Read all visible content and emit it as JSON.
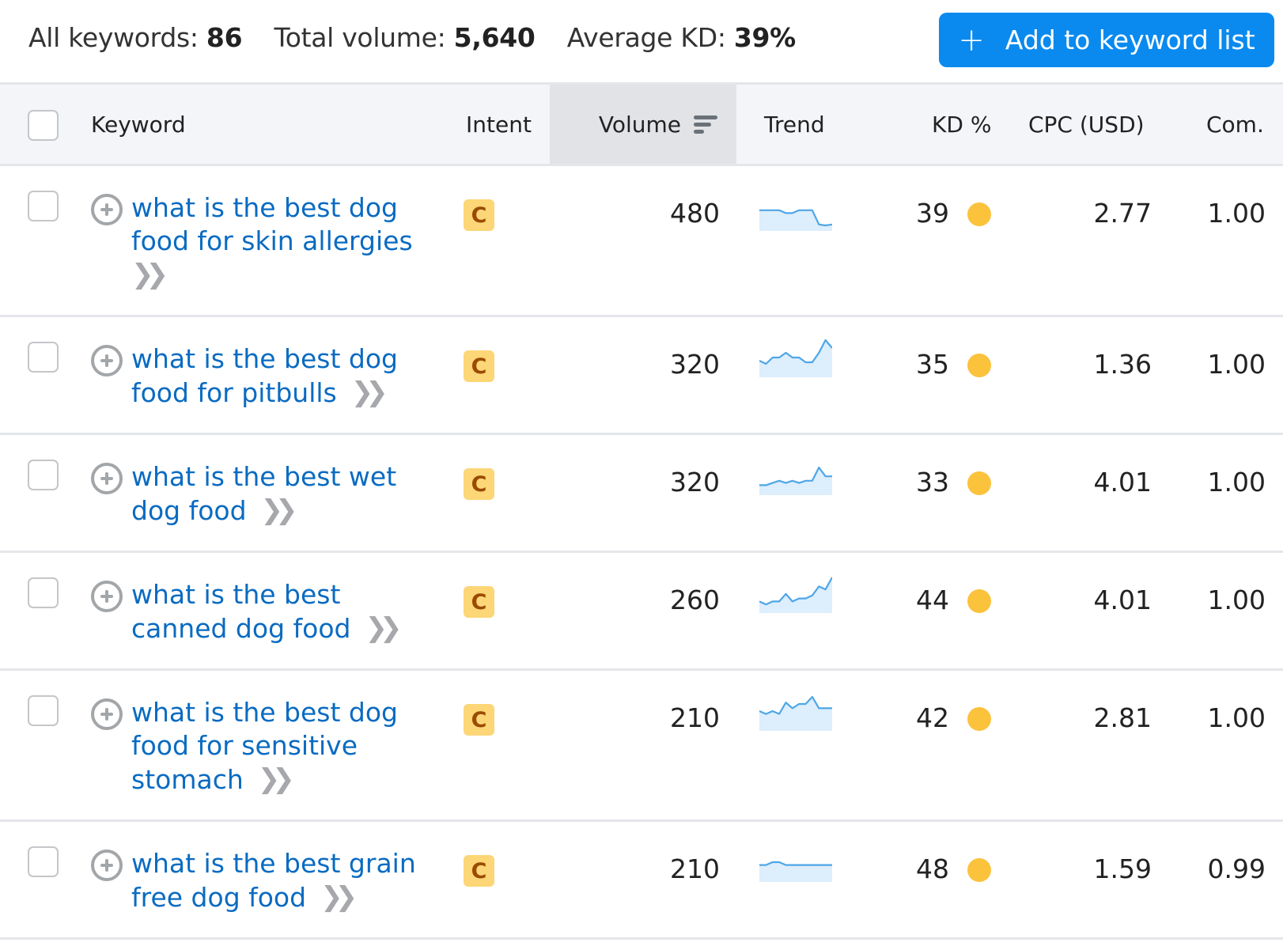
{
  "summary": {
    "all_keywords_label": "All keywords:",
    "all_keywords_value": "86",
    "total_volume_label": "Total volume:",
    "total_volume_value": "5,640",
    "avg_kd_label": "Average KD:",
    "avg_kd_value": "39%"
  },
  "toolbar": {
    "add_button_icon": "+",
    "add_button_label": "Add to keyword list"
  },
  "colors": {
    "accent": "#0a8aef",
    "link": "#0a6bc1",
    "intent_badge_bg": "#fcd677",
    "intent_badge_text": "#9a4b00",
    "kd_dot": "#fbc23c",
    "sparkline": "#4ea6e8",
    "sparkline_fill": "#ddeefc"
  },
  "table": {
    "columns": {
      "keyword": "Keyword",
      "intent": "Intent",
      "volume": "Volume",
      "trend": "Trend",
      "kd": "KD %",
      "cpc": "CPC (USD)",
      "com": "Com."
    },
    "sorted_by": "volume",
    "rows": [
      {
        "keyword": "what is the best dog food for skin allergies",
        "intent": "C",
        "volume": "480",
        "trend": [
          0.8,
          0.8,
          0.8,
          0.8,
          0.65,
          0.65,
          0.8,
          0.8,
          0.8,
          0.05,
          0.0,
          0.05
        ],
        "kd": "39",
        "cpc": "2.77",
        "com": "1.00"
      },
      {
        "keyword": "what is the best dog food for pitbulls",
        "intent": "C",
        "volume": "320",
        "trend": [
          0.35,
          0.25,
          0.45,
          0.45,
          0.6,
          0.45,
          0.45,
          0.3,
          0.3,
          0.6,
          1.0,
          0.75
        ],
        "kd": "35",
        "cpc": "1.36",
        "com": "1.00"
      },
      {
        "keyword": "what is the best wet dog food",
        "intent": "C",
        "volume": "320",
        "trend": [
          0.2,
          0.2,
          0.3,
          0.4,
          0.3,
          0.4,
          0.3,
          0.4,
          0.4,
          1.0,
          0.6,
          0.6
        ],
        "kd": "33",
        "cpc": "4.01",
        "com": "1.00"
      },
      {
        "keyword": "what is the best canned dog food",
        "intent": "C",
        "volume": "260",
        "trend": [
          0.2,
          0.1,
          0.2,
          0.2,
          0.45,
          0.2,
          0.3,
          0.3,
          0.4,
          0.7,
          0.6,
          1.0
        ],
        "kd": "44",
        "cpc": "4.01",
        "com": "1.00"
      },
      {
        "keyword": "what is the best dog food for sensitive stomach",
        "intent": "C",
        "volume": "210",
        "trend": [
          0.5,
          0.4,
          0.5,
          0.4,
          0.8,
          0.6,
          0.75,
          0.75,
          1.0,
          0.6,
          0.6,
          0.6
        ],
        "kd": "42",
        "cpc": "2.81",
        "com": "1.00"
      },
      {
        "keyword": "what is the best grain free dog food",
        "intent": "C",
        "volume": "210",
        "trend": [
          0.8,
          0.8,
          1.0,
          1.0,
          0.8,
          0.8,
          0.8,
          0.8,
          0.8,
          0.8,
          0.8,
          0.8
        ],
        "kd": "48",
        "cpc": "1.59",
        "com": "0.99"
      }
    ]
  }
}
